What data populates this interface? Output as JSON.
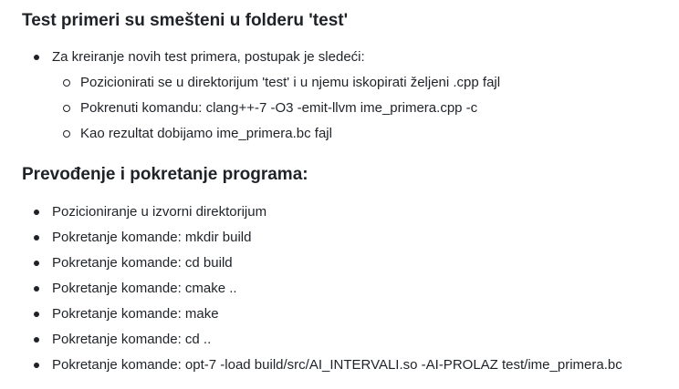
{
  "sections": [
    {
      "heading": "Test primeri su smešteni u folderu 'test'",
      "items": [
        {
          "text": "Za kreiranje novih test primera, postupak je sledeći:",
          "subitems": [
            "Pozicionirati se u direktorijum 'test' i u njemu iskopirati željeni .cpp fajl",
            "Pokrenuti komandu: clang++-7 -O3 -emit-llvm ime_primera.cpp -c",
            "Kao rezultat dobijamo ime_primera.bc fajl"
          ]
        }
      ]
    },
    {
      "heading": "Prevođenje i pokretanje programa:",
      "items": [
        "Pozicioniranje u izvorni direktorijum",
        "Pokretanje komande: mkdir build",
        "Pokretanje komande: cd build",
        "Pokretanje komande: cmake ..",
        "Pokretanje komande: make",
        "Pokretanje komande: cd ..",
        "Pokretanje komande: opt-7 -load build/src/AI_INTERVALI.so -AI-PROLAZ test/ime_primera.bc"
      ]
    }
  ]
}
